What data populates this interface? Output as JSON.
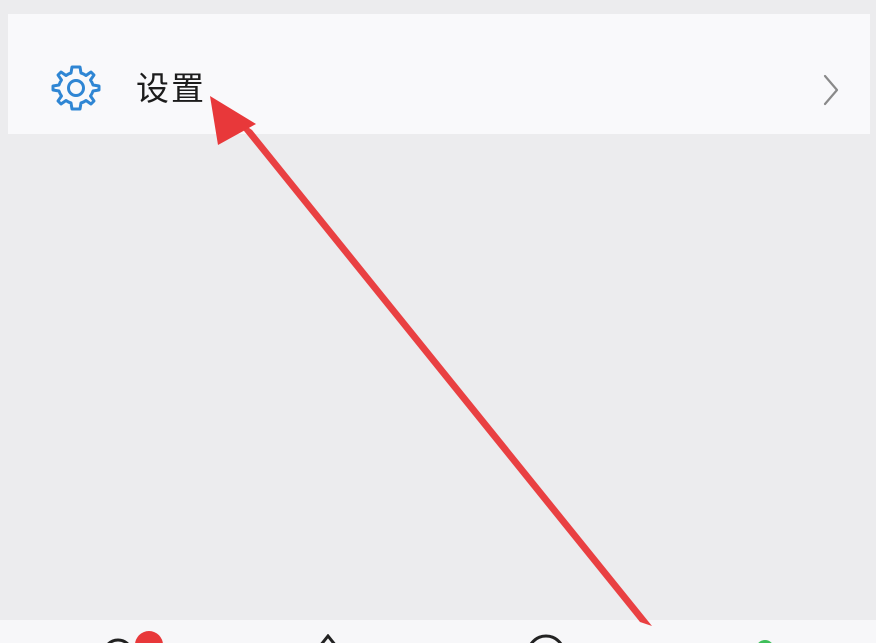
{
  "settings_row": {
    "label": "设置",
    "icon": "gear-icon",
    "chevron": "chevron-right-icon"
  },
  "tab_bar": {
    "icons": [
      "home-icon",
      "discover-icon",
      "message-icon",
      "profile-icon"
    ],
    "badge_color": "#e8383a"
  },
  "annotation": {
    "type": "arrow",
    "color": "#e8383a",
    "points_to": "settings-label"
  },
  "colors": {
    "accent": "#2f86d4",
    "background": "#ececee",
    "row_background": "#f9f9fb",
    "text": "#1c1c1c",
    "chevron": "#8a8a8a"
  }
}
